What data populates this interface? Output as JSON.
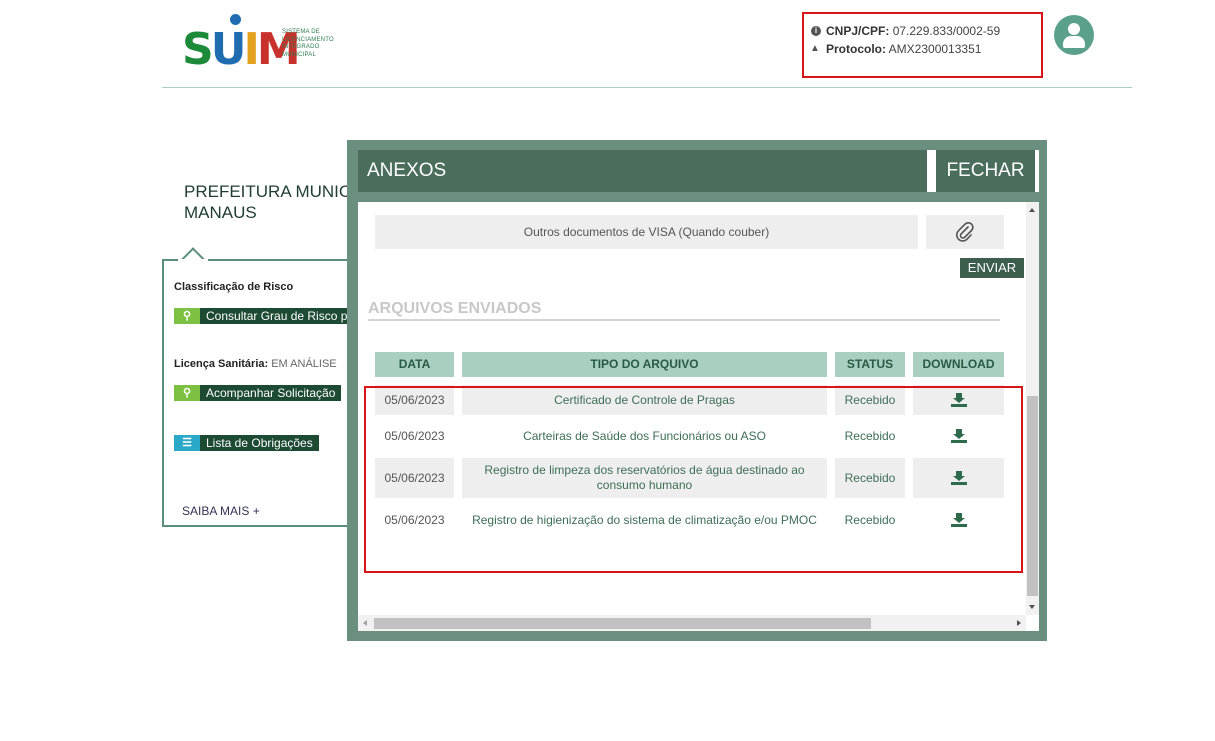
{
  "logo": {
    "mark": [
      "S",
      "U",
      "I",
      "M"
    ],
    "subtitle_lines": [
      "Sistema de",
      "Licenciamento",
      "Integrado",
      "Municipal"
    ]
  },
  "info": {
    "cnpj_label": "CNPJ/CPF:",
    "cnpj_value": "07.229.833/0002-59",
    "protocol_label": "Protocolo:",
    "protocol_value": "AMX2300013351"
  },
  "background": {
    "title_line1": "PREFEITURA MUNIC",
    "title_line2": "MANAUS",
    "risk_label": "Classificação de Risco",
    "risk_button": "Consultar Grau de Risco p",
    "license_label": "Licença Sanitária:",
    "license_value": "EM ANÁLISE",
    "follow_button": "Acompanhar Solicitação",
    "obligations_button": "Lista de Obrigações",
    "saiba_mais": "SAIBA MAIS +"
  },
  "modal": {
    "title": "ANEXOS",
    "close_label": "FECHAR",
    "upload_doc_label": "Outros documentos de VISA (Quando couber)",
    "send_label": "ENVIAR",
    "section_title": "ARQUIVOS ENVIADOS",
    "columns": [
      "DATA",
      "TIPO DO ARQUIVO",
      "STATUS",
      "DOWNLOAD"
    ],
    "rows": [
      {
        "date": "05/06/2023",
        "type": "Certificado de Controle de Pragas",
        "status": "Recebido"
      },
      {
        "date": "05/06/2023",
        "type": "Carteiras de Saúde dos Funcionários ou ASO",
        "status": "Recebido"
      },
      {
        "date": "05/06/2023",
        "type": "Registro de limpeza dos reservatórios de água destinado ao consumo humano",
        "status": "Recebido"
      },
      {
        "date": "05/06/2023",
        "type": "Registro de higienização do sistema de climatização e/ou PMOC",
        "status": "Recebido"
      }
    ]
  },
  "colors": {
    "header_green": "#4b6e5c",
    "modal_border": "#6a8f7e",
    "table_header": "#a9cfc0",
    "highlight_red": "#d7141a",
    "avatar": "#5aa08c"
  },
  "icons": [
    "info-icon",
    "warning-icon",
    "user-icon",
    "search-icon",
    "list-icon",
    "paperclip-icon",
    "download-icon"
  ]
}
